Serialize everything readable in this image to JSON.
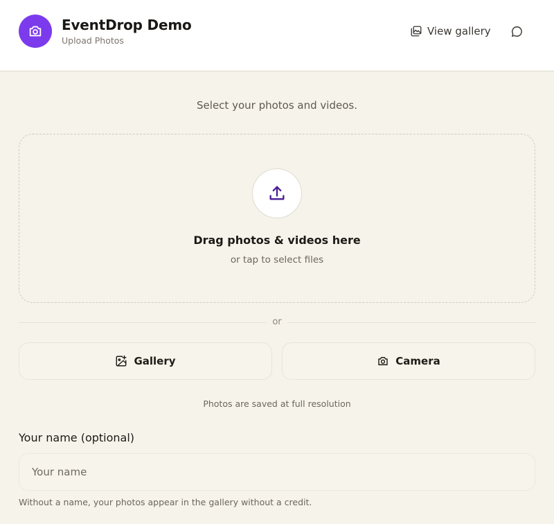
{
  "header": {
    "title": "EventDrop Demo",
    "subtitle": "Upload Photos",
    "view_gallery_label": "View gallery",
    "logo_icon": "camera-icon",
    "accent_color": "#7c3aed"
  },
  "upload": {
    "intro": "Select your photos and videos.",
    "drop_title": "Drag photos & videos here",
    "drop_subtitle": "or tap to select files",
    "or_label": "or",
    "gallery_label": "Gallery",
    "camera_label": "Camera",
    "resolution_note": "Photos are saved at full resolution"
  },
  "name_field": {
    "label": "Your name (optional)",
    "placeholder": "Your name",
    "value": "",
    "hint": "Without a name, your photos appear in the gallery without a credit."
  }
}
